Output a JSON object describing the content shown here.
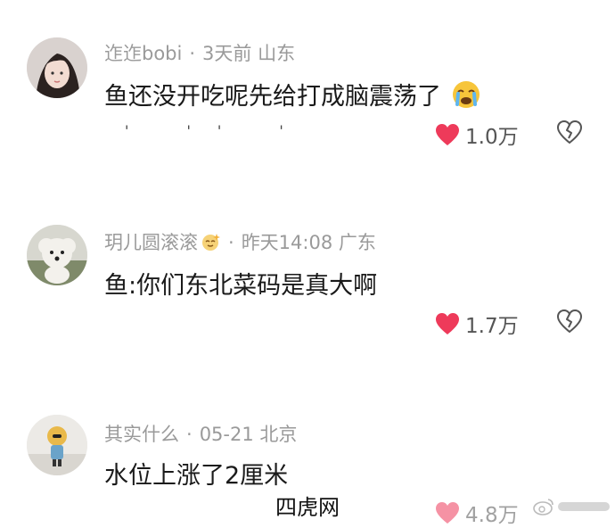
{
  "comments": [
    {
      "username": "迮迮bobi",
      "time": "3天前",
      "location": "山东",
      "text": "鱼还没开吃呢先给打成脑震荡了",
      "likes": "1.0万",
      "avatar_icon": "girl-avatar-icon"
    },
    {
      "username": "玥儿圆滚滚",
      "time": "昨天14:08",
      "location": "广东",
      "text": "鱼:你们东北菜码是真大啊",
      "likes": "1.7万",
      "avatar_icon": "dog-avatar-icon"
    },
    {
      "username": "其实什么",
      "time": "05-21",
      "location": "北京",
      "text": "水位上涨了2厘米",
      "likes": "4.8万",
      "avatar_icon": "figure-avatar-icon"
    }
  ],
  "separator": "·",
  "watermark": "四虎网",
  "colors": {
    "heart": "#ee3a5a",
    "meta": "#9a9a9a",
    "text": "#1a1a1a"
  }
}
